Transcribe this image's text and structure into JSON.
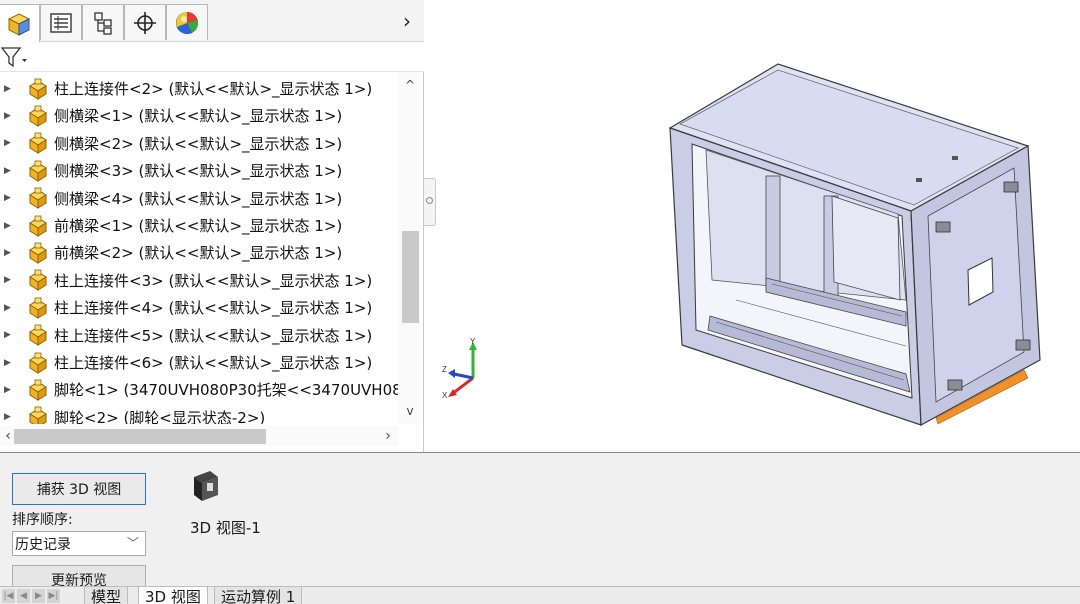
{
  "feature_manager": {
    "tabs": [
      {
        "icon": "feature-manager-icon",
        "active": true
      },
      {
        "icon": "property-manager-icon",
        "active": false
      },
      {
        "icon": "configuration-manager-icon",
        "active": false
      },
      {
        "icon": "dimxpert-manager-icon",
        "active": false
      },
      {
        "icon": "display-manager-icon",
        "active": false
      }
    ],
    "filter_icon": "filter-icon",
    "tree_items": [
      {
        "label": "柱上连接件<2> (默认<<默认>_显示状态 1>)"
      },
      {
        "label": "侧横梁<1> (默认<<默认>_显示状态 1>)"
      },
      {
        "label": "侧横梁<2> (默认<<默认>_显示状态 1>)"
      },
      {
        "label": "侧横梁<3> (默认<<默认>_显示状态 1>)"
      },
      {
        "label": "侧横梁<4> (默认<<默认>_显示状态 1>)"
      },
      {
        "label": "前横梁<1> (默认<<默认>_显示状态 1>)"
      },
      {
        "label": "前横梁<2> (默认<<默认>_显示状态 1>)"
      },
      {
        "label": "柱上连接件<3> (默认<<默认>_显示状态 1>)"
      },
      {
        "label": "柱上连接件<4> (默认<<默认>_显示状态 1>)"
      },
      {
        "label": "柱上连接件<5> (默认<<默认>_显示状态 1>)"
      },
      {
        "label": "柱上连接件<6> (默认<<默认>_显示状态 1>)"
      },
      {
        "label": "脚轮<1> (3470UVH080P30托架<<3470UVH080"
      },
      {
        "label": "脚轮<2> (脚轮<显示状态-2>)"
      }
    ],
    "vertical_scroll_position": 0.63,
    "horizontal_scroll_position": 0.0
  },
  "triad": {
    "x_label": "X",
    "y_label": "Y",
    "z_label": "Z"
  },
  "colors": {
    "accent": "#2a6fd6",
    "model_face": "#d6d9f0",
    "model_edge": "#3a3a3a",
    "caster_orange": "#f0902a"
  },
  "bottom_panel": {
    "capture_button": "捕获 3D 视图",
    "sort_label": "排序顺序:",
    "sort_value": "历史记录",
    "refresh_button": "更新预览",
    "views": [
      {
        "name": "3D 视图-1"
      }
    ]
  },
  "bottom_tabs": [
    {
      "label": "模型",
      "active": false
    },
    {
      "label": "3D 视图",
      "active": true
    },
    {
      "label": "运动算例 1",
      "active": false
    }
  ]
}
